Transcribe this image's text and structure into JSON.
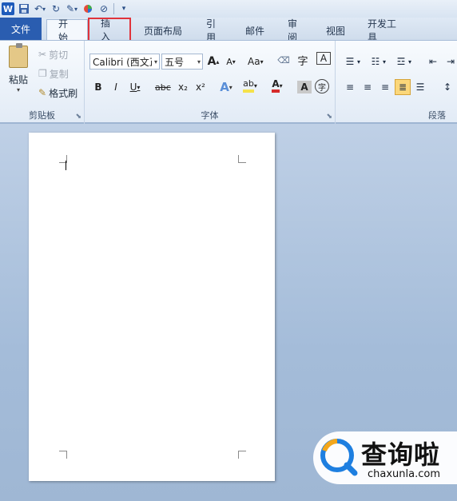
{
  "qat": {
    "app_icon": "W",
    "icons": [
      "save-icon",
      "undo-icon",
      "redo-icon",
      "format-painter-icon",
      "color-icon",
      "clear-format-icon",
      "customize-icon"
    ]
  },
  "tabs": [
    {
      "label": "文件"
    },
    {
      "label": "开始"
    },
    {
      "label": "插入"
    },
    {
      "label": "页面布局"
    },
    {
      "label": "引用"
    },
    {
      "label": "邮件"
    },
    {
      "label": "审阅"
    },
    {
      "label": "视图"
    },
    {
      "label": "开发工具"
    }
  ],
  "clipboard": {
    "paste_label": "粘贴",
    "cut_label": "剪切",
    "copy_label": "复制",
    "format_painter_label": "格式刷",
    "group_label": "剪贴板"
  },
  "font": {
    "font_name": "Calibri (西文正",
    "font_size": "五号",
    "grow": "A",
    "shrink": "A",
    "change_case": "Aa",
    "bold": "B",
    "italic": "I",
    "underline": "U",
    "strike": "abc",
    "subscript": "x₂",
    "superscript": "x²",
    "char_border": "A",
    "phonetic": "字",
    "enclose": "字",
    "group_label": "字体"
  },
  "paragraph": {
    "group_label": "段落"
  },
  "watermark": {
    "brand": "查询啦",
    "url": "chaxunla.com"
  },
  "colors": {
    "file_tab": "#2a5db0",
    "highlight": "#e0333b",
    "font_color": "#d62b2b",
    "highlight_color": "#f5e24b"
  }
}
